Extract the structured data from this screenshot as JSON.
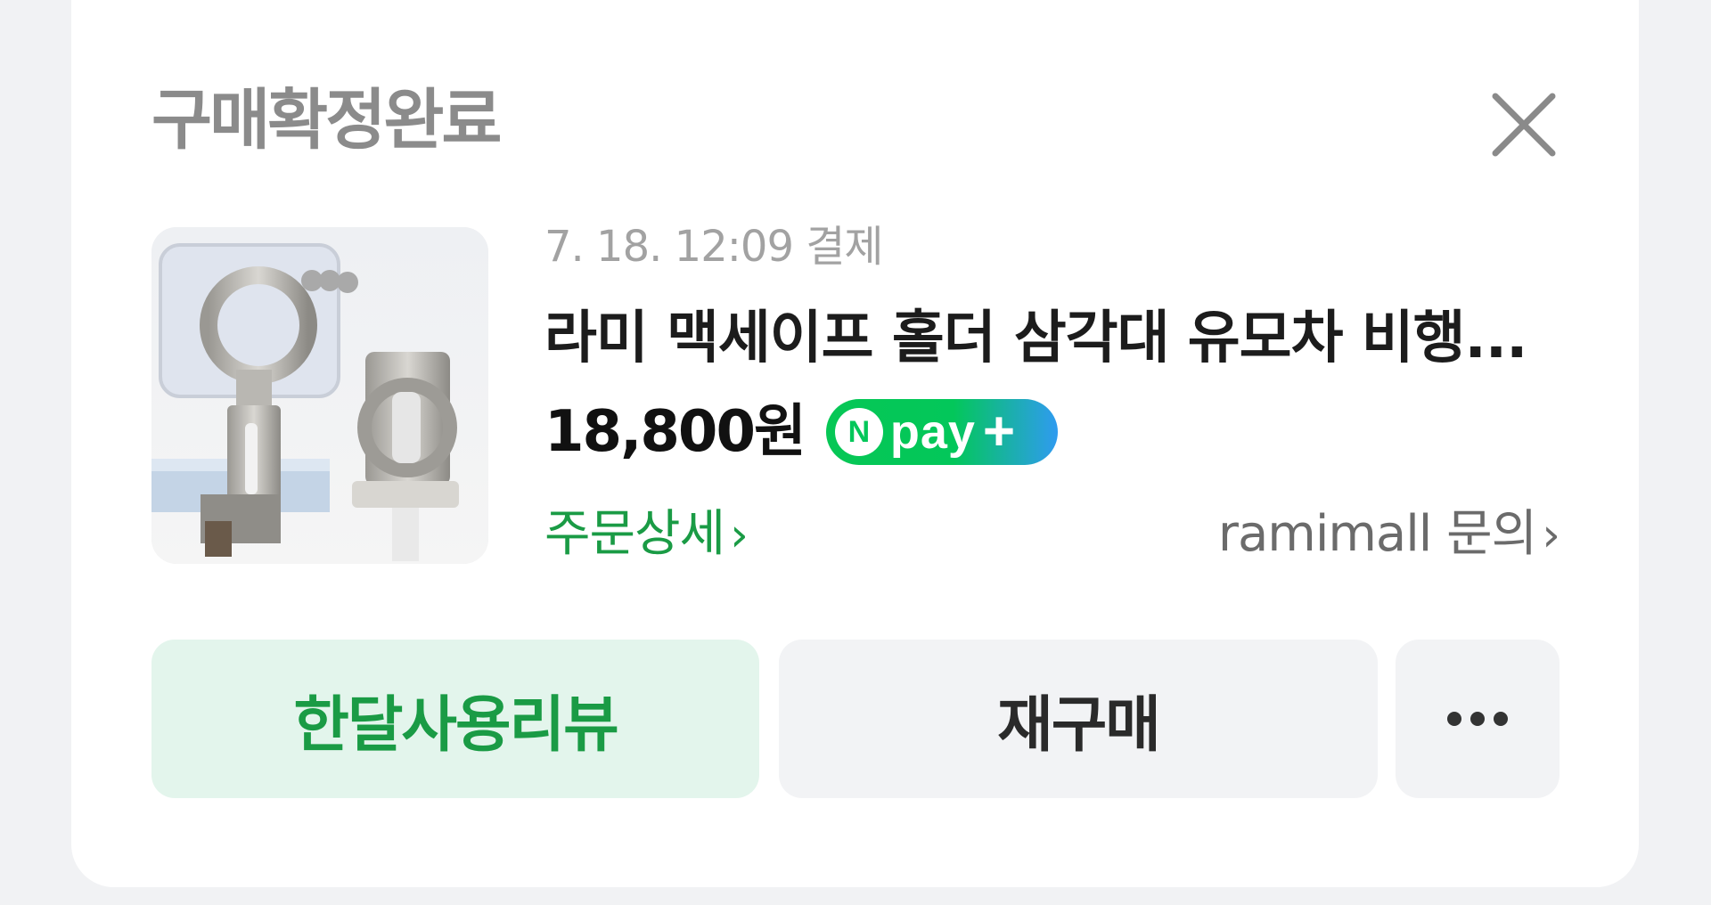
{
  "card": {
    "title": "구매확정완료",
    "close_icon": "close-icon"
  },
  "order": {
    "payment_info": "7. 18. 12:09 결제",
    "product_name": "라미 맥세이프 홀더 삼각대 유모차 비행...",
    "price": "18,800원",
    "npay_badge": {
      "n_letter": "N",
      "text": "pay",
      "plus": "+"
    },
    "detail_link": "주문상세",
    "inquiry_link": "ramimall 문의",
    "chevron": "›"
  },
  "actions": {
    "review_label": "한달사용리뷰",
    "rebuy_label": "재구매",
    "more_icon": "more-horizontal-icon"
  },
  "colors": {
    "accent_green": "#1a9b45",
    "review_bg": "#e3f5ec",
    "neutral_bg": "#f2f3f5",
    "page_bg": "#f1f2f4"
  }
}
